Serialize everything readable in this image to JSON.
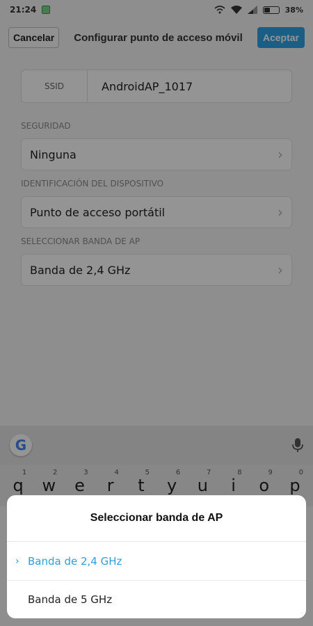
{
  "status_bar": {
    "time": "21:24",
    "battery": "38%"
  },
  "header": {
    "cancel": "Cancelar",
    "title": "Configurar punto de acceso móvil",
    "accept": "Aceptar"
  },
  "ssid": {
    "label": "SSID",
    "value": "AndroidAP_1017"
  },
  "security": {
    "section": "SEGURIDAD",
    "value": "Ninguna"
  },
  "device_id": {
    "section": "IDENTIFICACIÓN DEL DISPOSITIVO",
    "value": "Punto de acceso portátil"
  },
  "band": {
    "section": "SELECCIONAR BANDA DE AP",
    "value": "Banda de 2,4 GHz"
  },
  "keyboard": {
    "keys": [
      "q",
      "w",
      "e",
      "r",
      "t",
      "y",
      "u",
      "i",
      "o",
      "p"
    ],
    "numbers": [
      "1",
      "2",
      "3",
      "4",
      "5",
      "6",
      "7",
      "8",
      "9",
      "0"
    ]
  },
  "dialog": {
    "title": "Seleccionar banda de AP",
    "options": [
      {
        "label": "Banda de 2,4 GHz",
        "selected": true
      },
      {
        "label": "Banda de 5 GHz",
        "selected": false
      }
    ]
  },
  "colors": {
    "accent": "#2fa3e6",
    "selected_text": "#2c9ee0"
  }
}
